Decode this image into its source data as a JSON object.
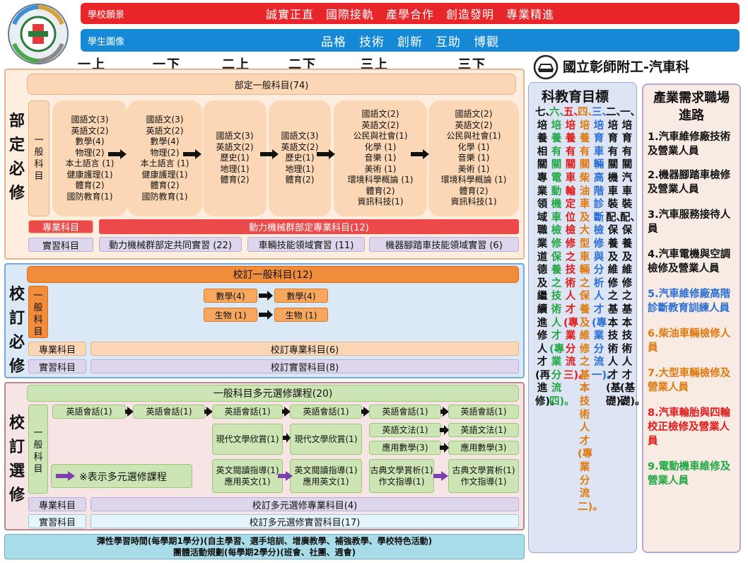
{
  "vision": {
    "label": "學校願景",
    "text": "誠實正直　國際接軌　產學合作　創造發明　專業精進"
  },
  "portrait": {
    "label": "學生圖像",
    "text": "品格　技術　創新　互助　博觀"
  },
  "years": [
    "一上",
    "一下",
    "二上",
    "二下",
    "三上",
    "三下"
  ],
  "school": "國立彰師附工-汽車科",
  "dept": {
    "label": "部定必修",
    "general": "部定一般科目(74)",
    "vert": "一般科目",
    "cards": [
      [
        "國語文(3)",
        "英語文(2)",
        "數學(4)",
        "物理(2)",
        "本土語言 (1)",
        "健康護理(1)",
        "體育(2)",
        "國防教育(1)"
      ],
      [
        "國語文(3)",
        "英語文(2)",
        "數學(4)",
        "物理(2)",
        "本土語言 (1)",
        "健康護理(1)",
        "體育(2)",
        "國防教育(1)"
      ],
      [
        "國語文(3)",
        "英語文(2)",
        "歷史(1)",
        "地理(1)",
        "體育(2)"
      ],
      [
        "國語文(3)",
        "英語文(2)",
        "歷史(1)",
        "地理(1)",
        "體育(2)"
      ],
      [
        "國語文(2)",
        "英語文(2)",
        "公民與社會(1)",
        "化學 (1)",
        "音樂 (1)",
        "美術 (1)",
        "環境科學概論 (1)",
        "體育(2)",
        "資訊科技(1)"
      ],
      [
        "國語文(2)",
        "英語文(2)",
        "公民與社會(1)",
        "化學 (1)",
        "音樂 (1)",
        "美術 (1)",
        "環境科學概論 (1)",
        "體育(2)",
        "資訊科技(1)"
      ]
    ],
    "pro_label": "專業科目",
    "pro": "動力機械群部定專業科目(12)",
    "prac_label": "實習科目",
    "prac": [
      "動力機械群部定共同實習 (22)",
      "車輛技能領域實習 (11)",
      "機器腳踏車技能領域實習 (6)"
    ]
  },
  "school_req": {
    "label": "校訂必修",
    "general": "校訂一般科目(12)",
    "vert": "一般科目",
    "math": [
      "數學(4)",
      "數學(4)"
    ],
    "bio": [
      "生物 (1)",
      "生物 (1)"
    ],
    "pro_label": "專業科目",
    "pro": "校訂專業科目(6)",
    "prac_label": "實習科目",
    "prac": "校訂實習科目(8)"
  },
  "elective": {
    "label": "校訂選修",
    "general": "一般科目多元選修課程(20)",
    "vert": "一般科目",
    "eng": [
      "英語會話(1)",
      "英語會話(1)",
      "英語會話(1)",
      "英語會話(1)",
      "英語會話(1)",
      "英語會話(1)"
    ],
    "modern": [
      "現代文學欣賞(1)",
      "現代文學欣賞(1)"
    ],
    "grammar": [
      "英語文法(1)",
      "英語文法(1)"
    ],
    "appmath": [
      "應用數學(3)",
      "應用數學(3)"
    ],
    "reading": [
      "英文閱讀指導(1)",
      "應用英文(1)"
    ],
    "reading2": [
      "英文閱讀指導(1)",
      "應用英文(1)"
    ],
    "classic": [
      "古典文學賞析(1)",
      "作文指導(1)"
    ],
    "classic2": [
      "古典文學賞析(1)",
      "作文指導(1)"
    ],
    "legend": "※表示多元選修課程",
    "pro_label": "專業科目",
    "pro": "校訂多元選修專業科目(4)",
    "prac_label": "實習科目",
    "prac": "校訂多元選修實習科目(17)"
  },
  "flex": [
    "彈性學習時間(每學期1學分)(自主學習、選手培訓、增廣教學、補強教學、學校特色活動)",
    "團體活動規劃(每學期2學分)(班會、社團、週會)"
  ],
  "goals": {
    "title": "科教育目標",
    "items": [
      "一、培育有關汽車裝配、保養及維修之基本技術人才(基礎)。",
      "二、培育有關機車裝配、保養及維修之基本技術人才(基礎)。",
      "三、培育車輛高階診斷檢修與分析人才(專業分流一)。",
      "四、培養有關柴油車及大型車輛之保養及維修之基本技術人才(專業分流二)。",
      "五、培養有關車輪定位檢修之技術人才(專業分流三)。",
      "六、培養有關電動機車檢修保養之技術人才(專業分流四)。",
      "七、培養相關專業領域職業道德及繼續進修人才(再進修)。"
    ]
  },
  "colors": {
    "goal": [
      "#111111",
      "#111111",
      "#2a6fd6",
      "#e07a10",
      "#e11a1a",
      "#21a844",
      "#111111"
    ],
    "ind": [
      "#111111",
      "#111111",
      "#111111",
      "#111111",
      "#2a6fd6",
      "#e07a10",
      "#e07a10",
      "#e11a1a",
      "#21a844"
    ]
  },
  "industry": {
    "title": "產業需求職場進路",
    "items": [
      "1.汽車維修廠技術及營業人員",
      "2.機器腳踏車檢修及營業人員",
      "3.汽車服務接待人員",
      "4.汽車電機與空調檢修及營業人員",
      "5.汽車維修廠高階診斷教育訓練人員",
      "6.柴油車輛檢修人員",
      "7.大型車輛檢修及營業人員",
      "8.汽車輪胎與四輪校正檢修及營業人員",
      "9.電動機車維修及營業人員"
    ]
  }
}
